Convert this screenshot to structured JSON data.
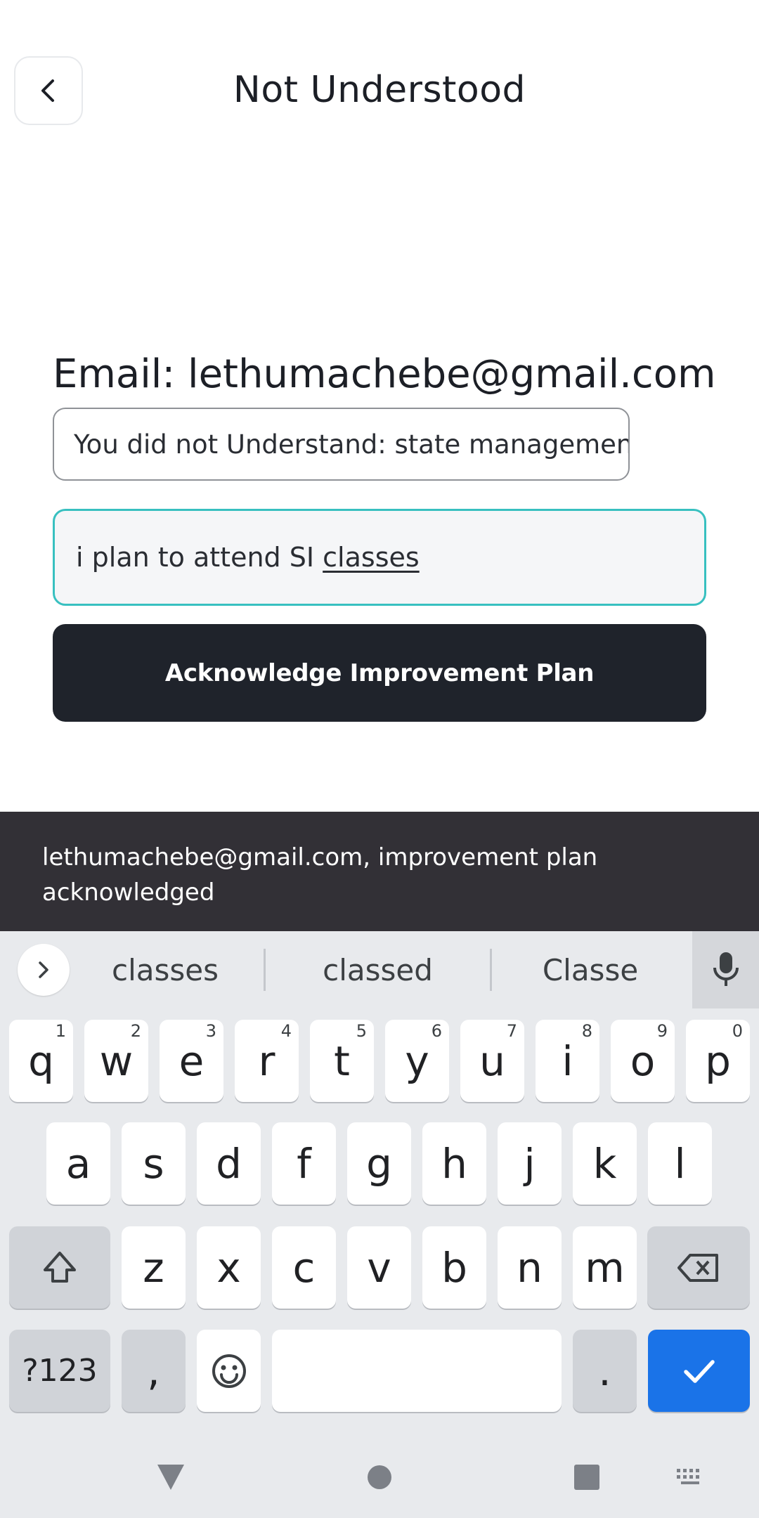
{
  "header": {
    "title": "Not Understood"
  },
  "form": {
    "email_label": "Email: lethumachebe@gmail.com",
    "topic_text": "You did not Understand: state management",
    "plan_value_start": "i plan to attend SI ",
    "plan_value_word": "classes",
    "ack_button": "Acknowledge Improvement Plan"
  },
  "snackbar": {
    "message": "lethumachebe@gmail.com, improvement plan acknowledged"
  },
  "keyboard": {
    "suggestions": [
      "classes",
      "classed",
      "Classe"
    ],
    "row1": [
      {
        "k": "q",
        "n": "1"
      },
      {
        "k": "w",
        "n": "2"
      },
      {
        "k": "e",
        "n": "3"
      },
      {
        "k": "r",
        "n": "4"
      },
      {
        "k": "t",
        "n": "5"
      },
      {
        "k": "y",
        "n": "6"
      },
      {
        "k": "u",
        "n": "7"
      },
      {
        "k": "i",
        "n": "8"
      },
      {
        "k": "o",
        "n": "9"
      },
      {
        "k": "p",
        "n": "0"
      }
    ],
    "row2": [
      "a",
      "s",
      "d",
      "f",
      "g",
      "h",
      "j",
      "k",
      "l"
    ],
    "row3": [
      "z",
      "x",
      "c",
      "v",
      "b",
      "n",
      "m"
    ],
    "symbols_key": "?123",
    "comma_key": ",",
    "period_key": "."
  }
}
